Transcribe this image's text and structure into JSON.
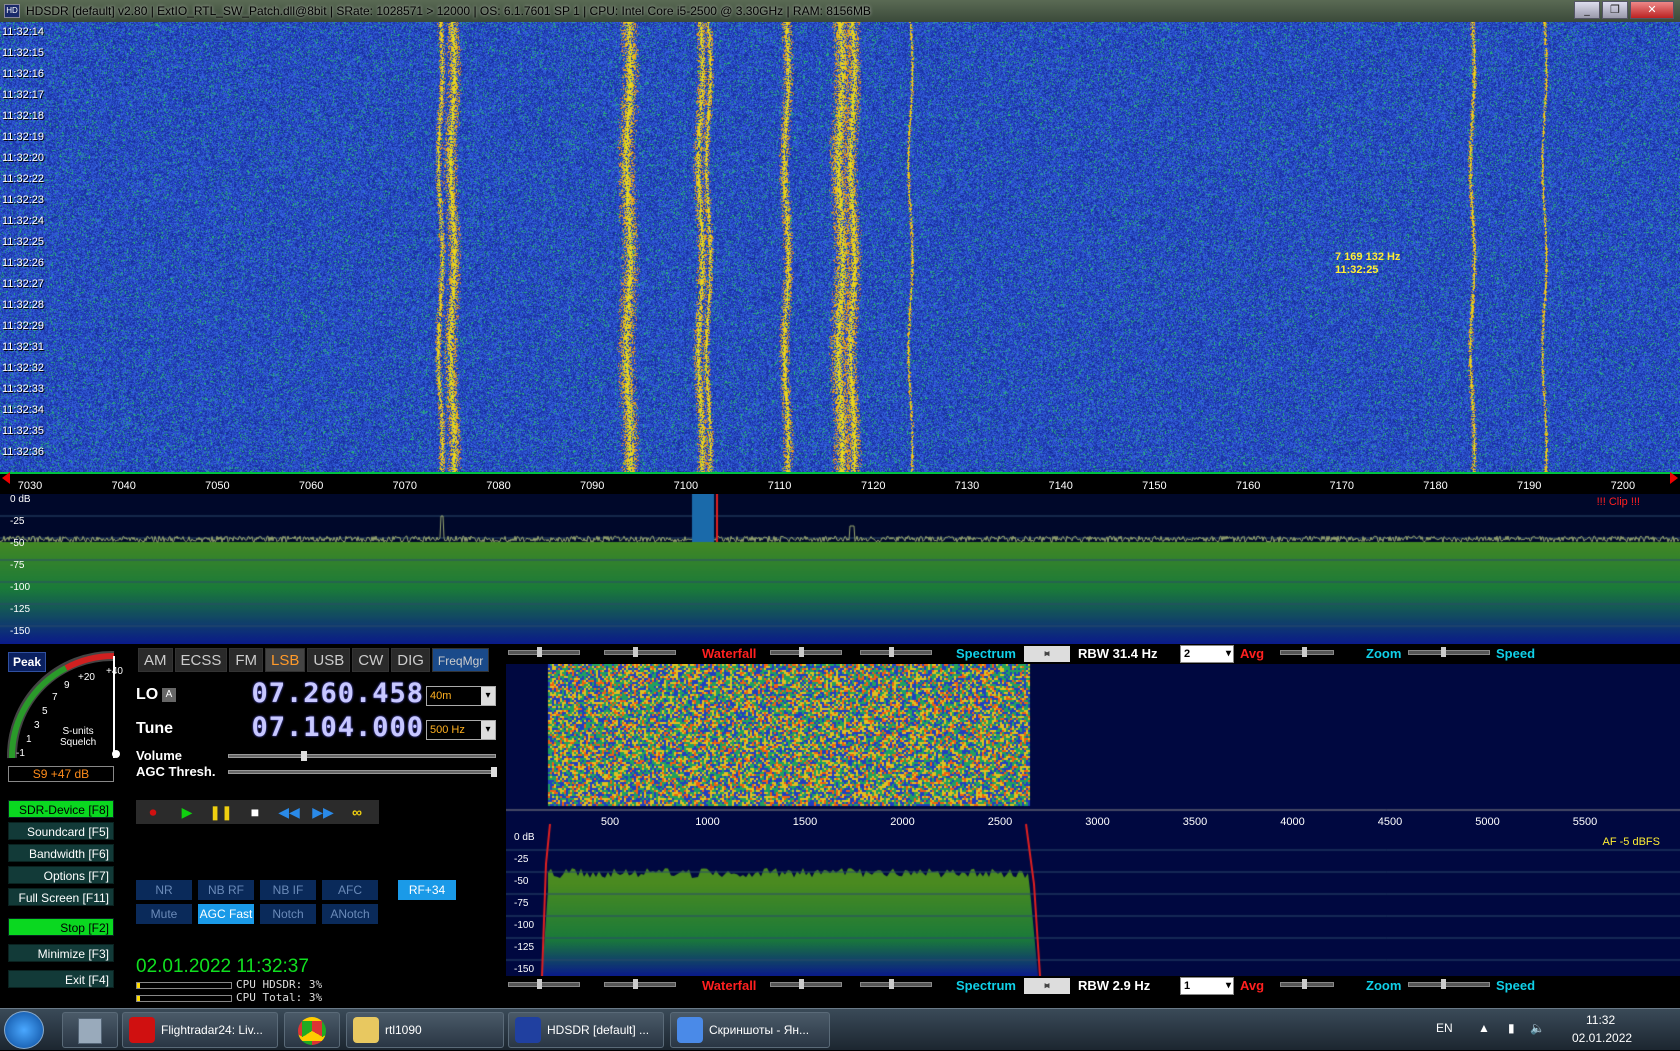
{
  "window": {
    "title": "HDSDR  [default]  v2.80   |   ExtIO_RTL_SW_Patch.dll@8bit   |   SRate: 1028571 > 12000   |   OS: 6.1.7601 SP 1   |   CPU: Intel Core i5-2500 @ 3.30GHz   |   RAM: 8156MB",
    "app_icon": "HD",
    "controls": {
      "minimize": "_",
      "restore": "❐",
      "close": "✕"
    }
  },
  "waterfall": {
    "times": [
      "11:32:14",
      "11:32:15",
      "11:32:16",
      "11:32:17",
      "11:32:18",
      "11:32:19",
      "11:32:20",
      "11:32:22",
      "11:32:23",
      "11:32:24",
      "11:32:25",
      "11:32:26",
      "11:32:27",
      "11:32:28",
      "11:32:29",
      "11:32:31",
      "11:32:32",
      "11:32:33",
      "11:32:34",
      "11:32:35",
      "11:32:36"
    ],
    "tooltip_freq": "7 169 132 Hz",
    "tooltip_time": "11:32:25"
  },
  "freq_axis": {
    "ticks": [
      "7030",
      "7040",
      "7050",
      "7060",
      "7070",
      "7080",
      "7090",
      "7100",
      "7110",
      "7120",
      "7130",
      "7140",
      "7150",
      "7160",
      "7170",
      "7180",
      "7190",
      "7200"
    ]
  },
  "spectrum": {
    "db_labels": [
      "0 dB",
      "-25",
      "-50",
      "-75",
      "-100",
      "-125",
      "-150"
    ],
    "clip": "!!! Clip !!!"
  },
  "smeter": {
    "peak_label": "Peak",
    "scale": [
      "-1",
      "1",
      "3",
      "5",
      "7",
      "9",
      "+20",
      "+40"
    ],
    "label1": "S-units",
    "label2": "Squelch",
    "reading": "S9 +47 dB"
  },
  "modes": [
    "AM",
    "ECSS",
    "FM",
    "LSB",
    "USB",
    "CW",
    "DIG"
  ],
  "freqmgr": "FreqMgr",
  "lo": {
    "label": "LO",
    "badge": "A",
    "freq": "07.260.458",
    "band": "40m"
  },
  "tune": {
    "label": "Tune",
    "freq": "07.104.000",
    "step": "500 Hz"
  },
  "volume_label": "Volume",
  "agc_label": "AGC Thresh.",
  "fkeys": [
    {
      "label": "SDR-Device  [F8]"
    },
    {
      "label": "Soundcard  [F5]"
    },
    {
      "label": "Bandwidth  [F6]"
    },
    {
      "label": "Options   [F7]"
    },
    {
      "label": "Full Screen  [F11]"
    },
    {
      "label": "Stop      [F2]"
    },
    {
      "label": "Minimize  [F3]"
    },
    {
      "label": "Exit      [F4]"
    }
  ],
  "transport_icons": [
    "record-icon",
    "play-icon",
    "pause-icon",
    "stop-icon",
    "rewind-icon",
    "forward-icon",
    "loop-icon"
  ],
  "dsp": {
    "row1": [
      "NR",
      "NB RF",
      "NB IF",
      "AFC"
    ],
    "rf": "RF+34",
    "row2": [
      "Mute",
      "AGC Fast",
      "Notch",
      "ANotch"
    ]
  },
  "datetime": "02.01.2022 11:32:37",
  "cpu": {
    "hdsdr": "CPU HDSDR: 3%",
    "total": "CPU Total: 3%"
  },
  "strip_top": {
    "waterfall": "Waterfall",
    "spectrum": "Spectrum",
    "rbw": "RBW 31.4 Hz",
    "avg_val": "2",
    "avg": "Avg",
    "zoom": "Zoom",
    "speed": "Speed"
  },
  "strip_bottom": {
    "waterfall": "Waterfall",
    "spectrum": "Spectrum",
    "rbw": "RBW  2.9 Hz",
    "avg_val": "1",
    "avg": "Avg",
    "zoom": "Zoom",
    "speed": "Speed"
  },
  "af": {
    "ticks": [
      "500",
      "1000",
      "1500",
      "2000",
      "2500",
      "3000",
      "3500",
      "4000",
      "4500",
      "5000",
      "5500"
    ],
    "db_labels": [
      "0 dB",
      "-25",
      "-50",
      "-75",
      "-100",
      "-125",
      "-150"
    ],
    "level": "AF   -5 dBFS"
  },
  "taskbar": {
    "items": [
      {
        "label": "Flightradar24: Liv...",
        "icon": "opera-icon",
        "color": "#d01010"
      },
      {
        "label": "rtl1090",
        "icon": "folder-icon",
        "color": "#e8c860"
      },
      {
        "label": "HDSDR  [default]  ...",
        "icon": "hdsdr-icon",
        "color": "#2040a0"
      },
      {
        "label": "Скриншоты - Ян...",
        "icon": "yandex-disk-icon",
        "color": "#4a8ae8"
      }
    ],
    "lang": "EN",
    "time": "11:32",
    "date": "02.01.2022"
  }
}
